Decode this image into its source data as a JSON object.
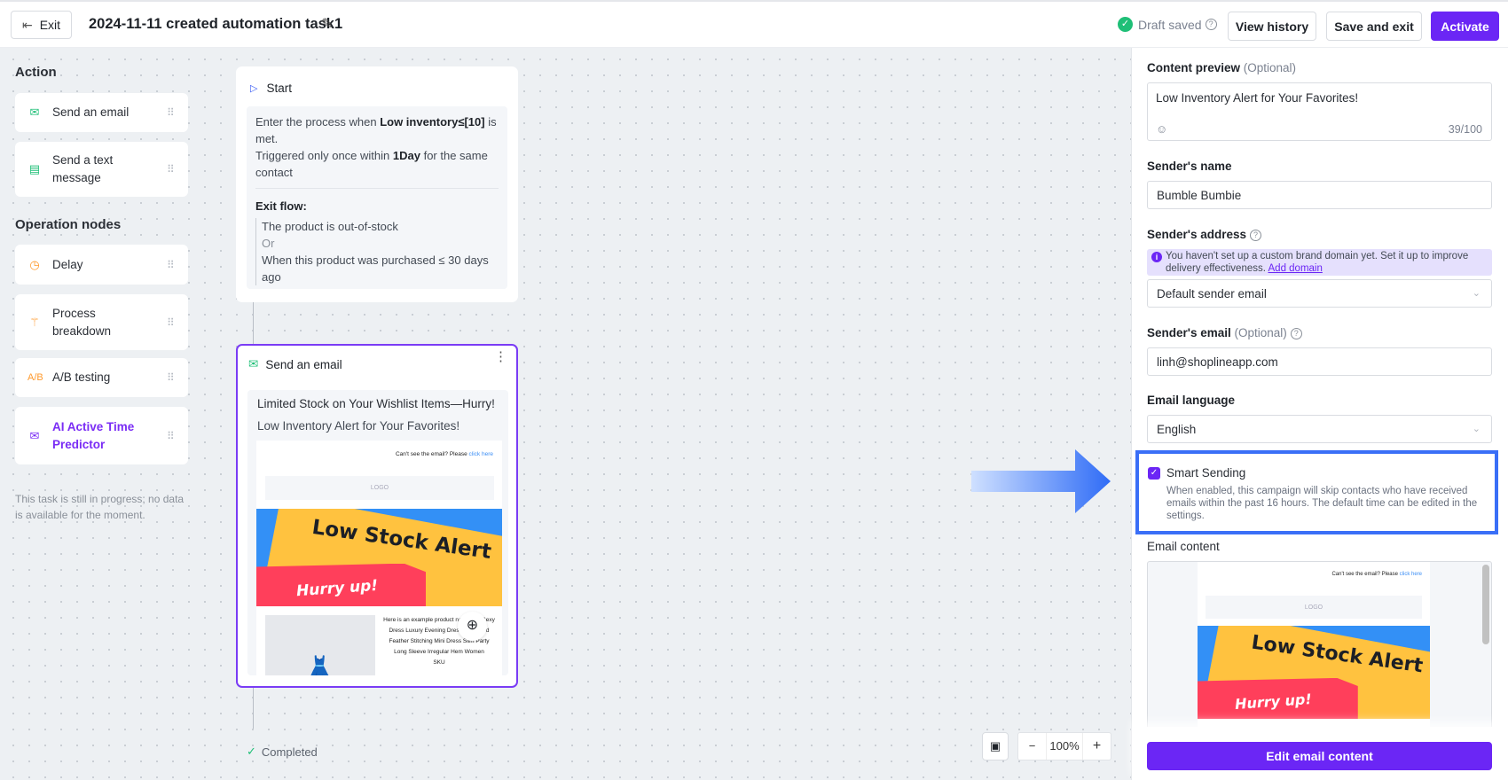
{
  "header": {
    "exit_label": "Exit",
    "title": "2024-11-11 created automation task1",
    "draft_status": "Draft saved",
    "view_history": "View history",
    "save_and_exit": "Save and exit",
    "activate": "Activate"
  },
  "colors": {
    "accent": "#6b26f5",
    "success": "#1fbf77",
    "highlight": "#3a6ff7"
  },
  "sidebar": {
    "action_title": "Action",
    "actions": [
      {
        "label": "Send an email",
        "icon": "mail-icon"
      },
      {
        "label": "Send a text message",
        "icon": "message-icon"
      }
    ],
    "operation_title": "Operation nodes",
    "operations": [
      {
        "label": "Delay",
        "icon": "clock-icon"
      },
      {
        "label": "Process breakdown",
        "icon": "branch-icon"
      },
      {
        "label": "A/B testing",
        "icon": "ab-icon"
      },
      {
        "label": "AI Active Time Predictor",
        "icon": "ai-mail-icon"
      }
    ],
    "note": "This task is still in progress; no data is available for the moment."
  },
  "flow": {
    "start": {
      "title": "Start",
      "enter_pre": "Enter the process when ",
      "enter_bold": "Low inventory≤[10]",
      "enter_post": " is met.",
      "trigger_pre": "Triggered only once within ",
      "trigger_bold": "1Day",
      "trigger_post": " for the same contact",
      "exit_title": "Exit flow:",
      "exit_1": "The product is out-of-stock",
      "exit_or": "Or",
      "exit_2": "When this product was purchased ≤ 30 days ago"
    },
    "email_node": {
      "title": "Send an email",
      "subject": "Limited Stock on Your Wishlist Items—Hurry!",
      "preview": "Low Inventory Alert for Your Favorites!"
    },
    "completed": "Completed",
    "zoom_level": "100%"
  },
  "email_preview": {
    "cant_see": "Can't see the email? Please ",
    "click_here": "click here",
    "logo": "LOGO",
    "banner_title": "Low Stock Alert",
    "banner_sub": "Hurry up!",
    "product_text": "Here is an example product name:Hot Sexy Dress Luxury Evening Dress Rose Red Feather Stitching Mini Dress Slim Party Long Sleeve Irregular Hem Women",
    "sku": "SKU"
  },
  "panel": {
    "content_preview_label": "Content preview",
    "optional": "(Optional)",
    "content_preview_value": "Low Inventory Alert for Your Favorites!",
    "char_count": "39/100",
    "sender_name_label": "Sender's name",
    "sender_name_value": "Bumble Bumbie",
    "sender_address_label": "Sender's address",
    "domain_notice": "You haven't set up a custom brand domain yet. Set it up to improve delivery effectiveness. ",
    "add_domain": "Add domain",
    "sender_address_value": "Default sender email",
    "sender_email_label": "Sender's email",
    "sender_email_value": "linh@shoplineapp.com",
    "language_label": "Email language",
    "language_value": "English",
    "smart_sending_label": "Smart Sending",
    "smart_sending_checked": true,
    "smart_sending_desc": "When enabled, this campaign will skip contacts who have received emails within the past 16 hours. The default time can be edited in the settings.",
    "email_content_label": "Email content",
    "edit_button": "Edit email content"
  }
}
